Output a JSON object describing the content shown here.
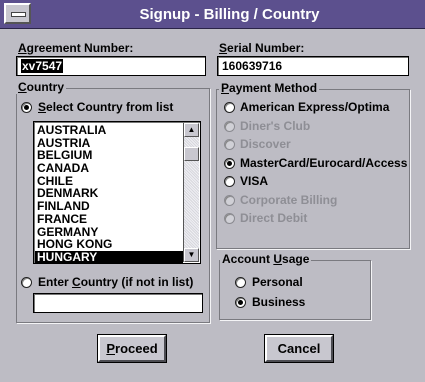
{
  "window": {
    "title": "Signup - Billing / Country"
  },
  "agreement": {
    "label_ul": "A",
    "label_rest": "greement Number:",
    "value": "xv7547"
  },
  "serial": {
    "label_ul": "S",
    "label_rest": "erial Number:",
    "value": "160639716"
  },
  "country": {
    "legend_ul": "C",
    "legend_rest": "ountry",
    "select_option": {
      "pre": "",
      "ul": "S",
      "post": "elect Country from list",
      "selected": true
    },
    "enter_option": {
      "pre": "Enter ",
      "ul": "C",
      "post": "ountry (if not in list)",
      "selected": false
    },
    "list": [
      "AUSTRALIA",
      "AUSTRIA",
      "BELGIUM",
      "CANADA",
      "CHILE",
      "DENMARK",
      "FINLAND",
      "FRANCE",
      "GERMANY",
      "HONG KONG",
      "HUNGARY"
    ],
    "selected_item": "HUNGARY",
    "entry_value": ""
  },
  "payment": {
    "legend_ul": "P",
    "legend_rest": "ayment Method",
    "options": [
      {
        "label": "American Express/Optima",
        "enabled": true,
        "selected": false
      },
      {
        "label": "Diner's Club",
        "enabled": false,
        "selected": false
      },
      {
        "label": "Discover",
        "enabled": false,
        "selected": false
      },
      {
        "label": "MasterCard/Eurocard/Access",
        "enabled": true,
        "selected": true
      },
      {
        "label": "VISA",
        "enabled": true,
        "selected": false
      },
      {
        "label": "Corporate Billing",
        "enabled": false,
        "selected": false
      },
      {
        "label": "Direct Debit",
        "enabled": false,
        "selected": false
      }
    ]
  },
  "usage": {
    "legend_pre": "Account ",
    "legend_ul": "U",
    "legend_post": "sage",
    "options": [
      {
        "label": "Personal",
        "selected": false
      },
      {
        "label": "Business",
        "selected": true
      }
    ]
  },
  "buttons": {
    "proceed": {
      "ul": "P",
      "rest": "roceed"
    },
    "cancel": {
      "label": "Cancel"
    }
  }
}
